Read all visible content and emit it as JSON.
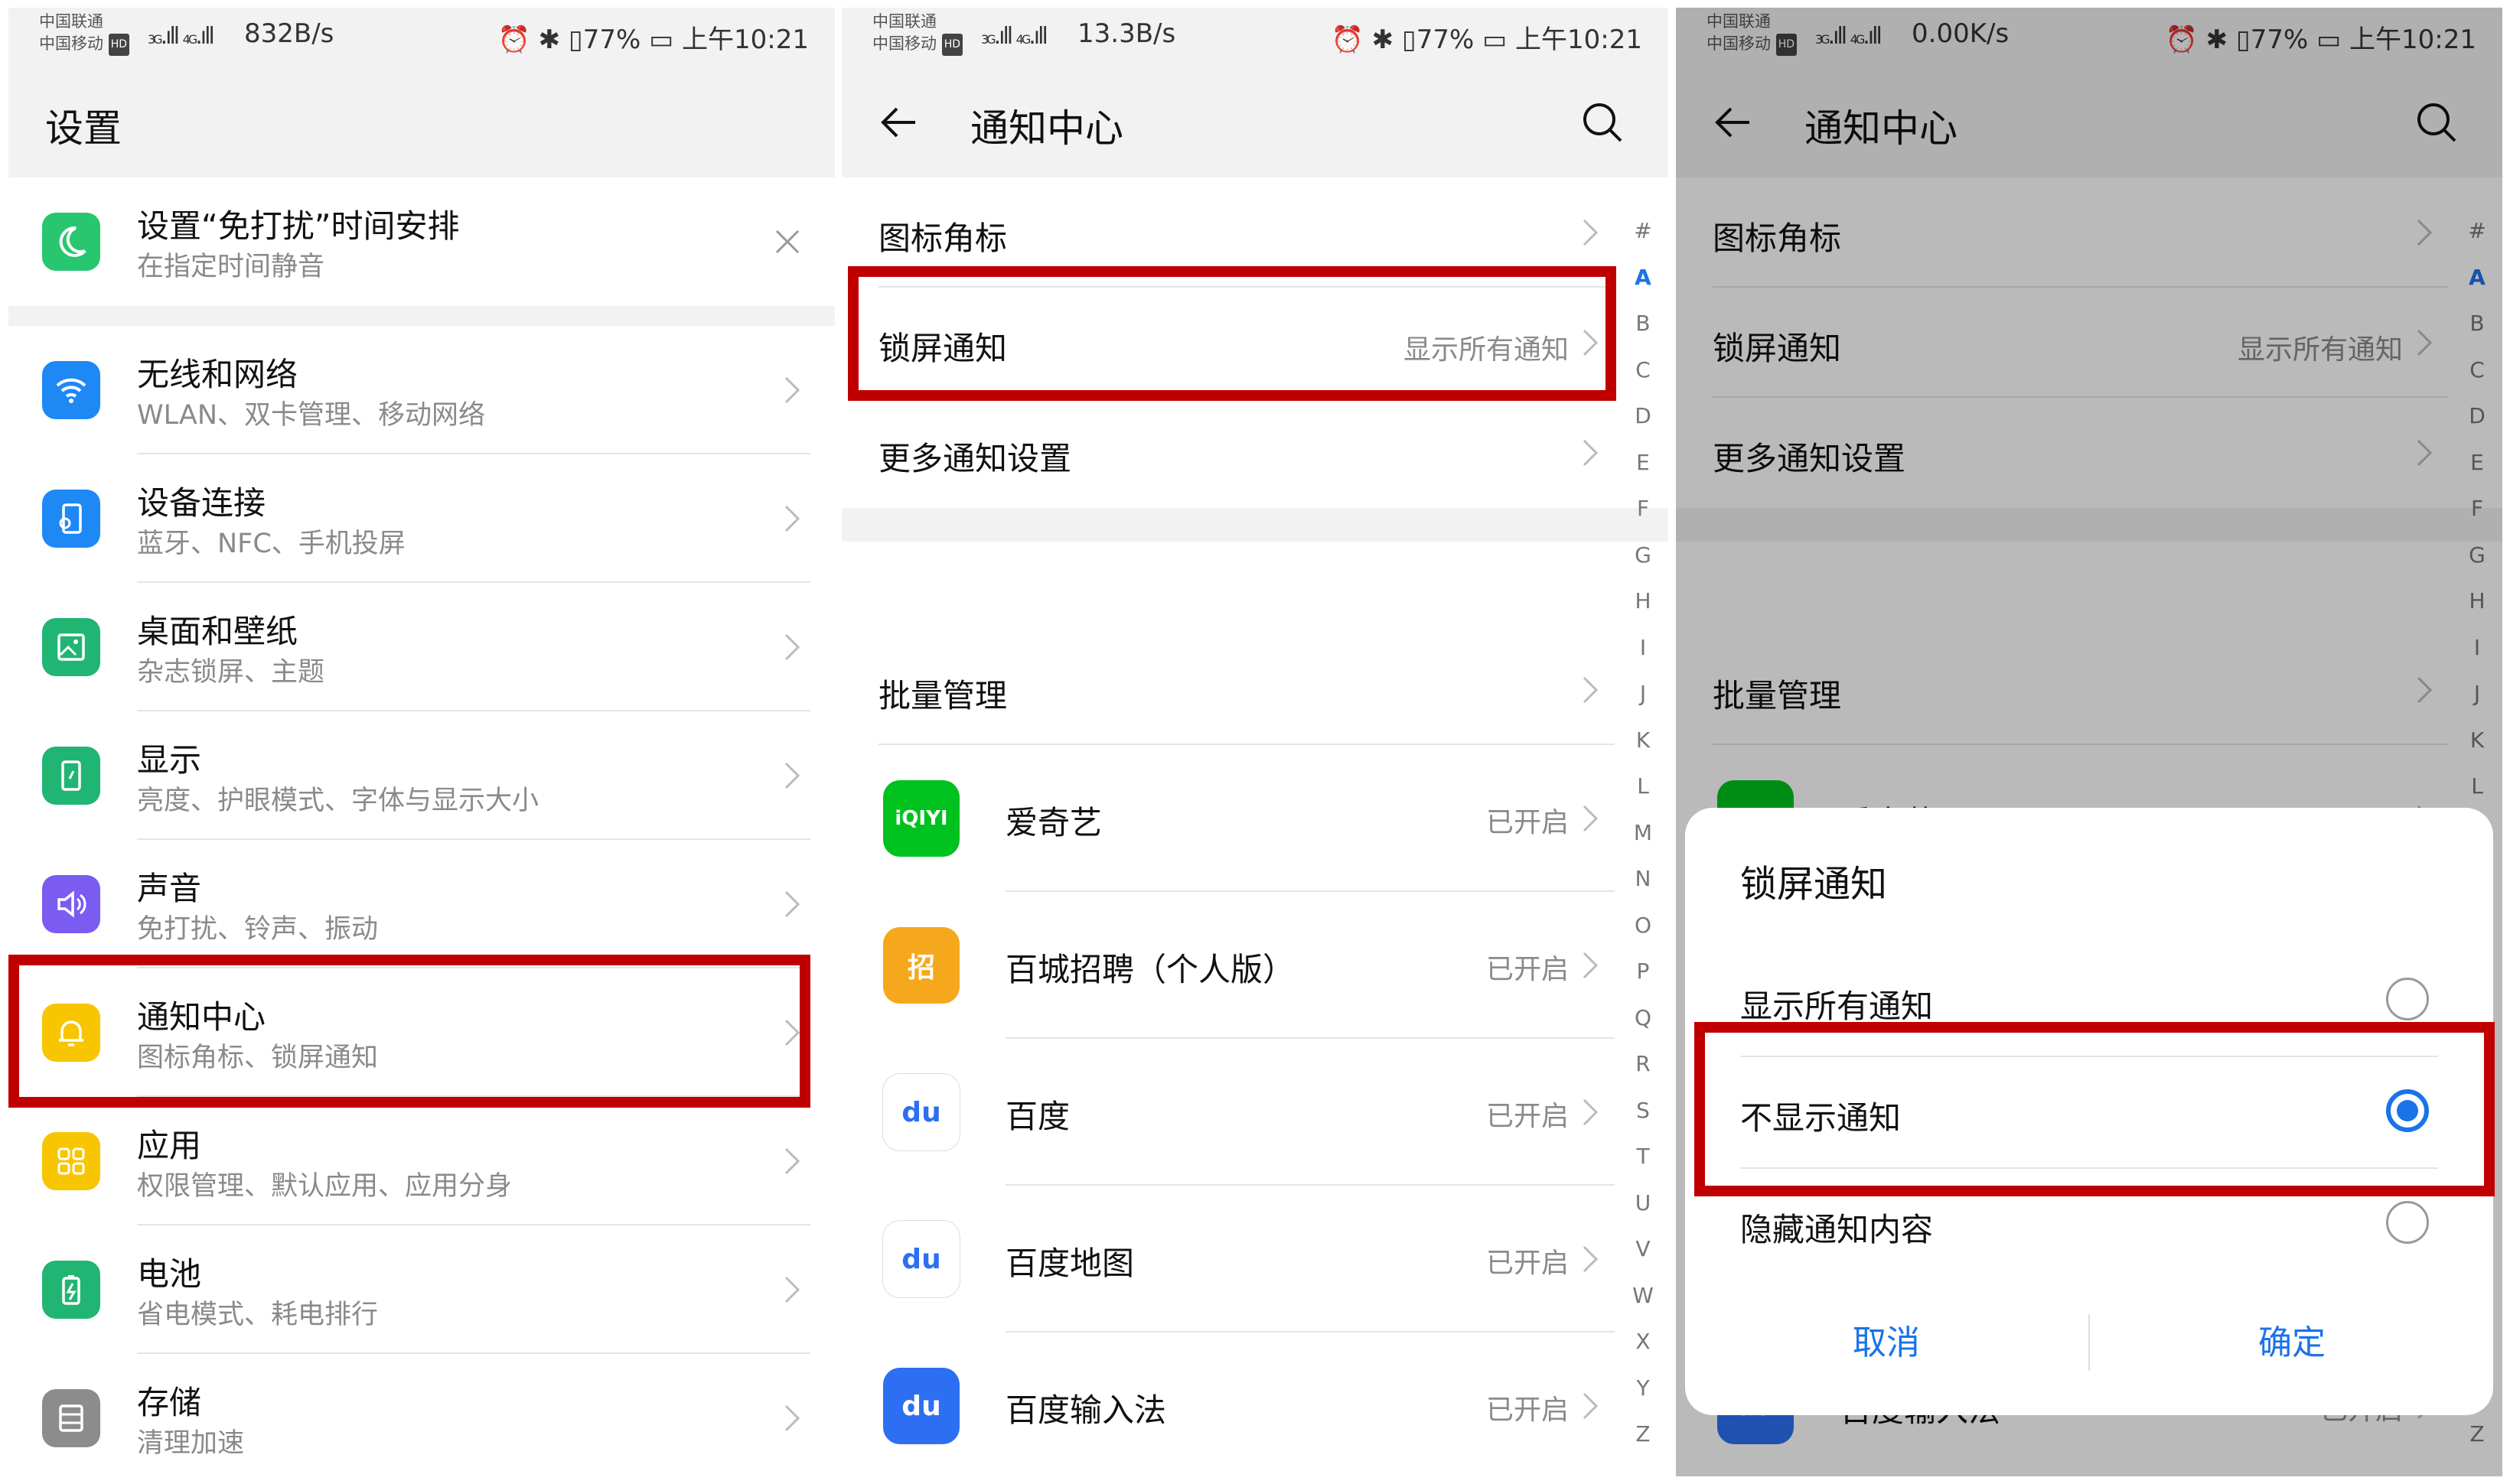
{
  "status_bars": [
    {
      "carrier1": "中国联通",
      "carrier2": "中国移动",
      "hd": "HD",
      "signal1": "3G",
      "signal2": "4G",
      "speed": "832B/s",
      "icons": "⏰ ✱ ▯",
      "battery": "77%",
      "time": "上午10:21"
    },
    {
      "carrier1": "中国联通",
      "carrier2": "中国移动",
      "hd": "HD",
      "signal1": "3G",
      "signal2": "4G",
      "speed": "13.3B/s",
      "icons": "⏰ ✱ ▯",
      "battery": "77%",
      "time": "上午10:21"
    },
    {
      "carrier1": "中国联通",
      "carrier2": "中国移动",
      "hd": "HD",
      "signal1": "3G",
      "signal2": "4G",
      "speed": "0.00K/s",
      "icons": "⏰ ✱ ▯",
      "battery": "77%",
      "time": "上午10:21"
    }
  ],
  "settings": {
    "title": "设置",
    "dnd": {
      "main": "设置“免打扰”时间安排",
      "sub": "在指定时间静音",
      "icon": "moon-icon",
      "color": "#28c76f"
    },
    "items": [
      {
        "main": "无线和网络",
        "sub": "WLAN、双卡管理、移动网络",
        "icon": "wifi-icon",
        "color": "#1e88f5"
      },
      {
        "main": "设备连接",
        "sub": "蓝牙、NFC、手机投屏",
        "icon": "device-connection-icon",
        "color": "#1e88f5"
      },
      {
        "main": "桌面和壁纸",
        "sub": "杂志锁屏、主题",
        "icon": "wallpaper-icon",
        "color": "#21b573"
      },
      {
        "main": "显示",
        "sub": "亮度、护眼模式、字体与显示大小",
        "icon": "display-icon",
        "color": "#21b573"
      },
      {
        "main": "声音",
        "sub": "免打扰、铃声、振动",
        "icon": "sound-icon",
        "color": "#7a5cf0"
      },
      {
        "main": "通知中心",
        "sub": "图标角标、锁屏通知",
        "icon": "bell-icon",
        "color": "#f7c600"
      },
      {
        "main": "应用",
        "sub": "权限管理、默认应用、应用分身",
        "icon": "apps-icon",
        "color": "#f7c600"
      },
      {
        "main": "电池",
        "sub": "省电模式、耗电排行",
        "icon": "battery-icon",
        "color": "#21b573"
      },
      {
        "main": "存储",
        "sub": "清理加速",
        "icon": "storage-icon",
        "color": "#8c8c8c"
      }
    ]
  },
  "notification_center": {
    "title": "通知中心",
    "badge_label": "图标角标",
    "lock_label": "锁屏通知",
    "lock_value": "显示所有通知",
    "more_label": "更多通知设置",
    "batch_label": "批量管理",
    "apps": [
      {
        "name": "爱奇艺",
        "status": "已开启",
        "icon": "iqiyi-icon",
        "color": "#00c21f",
        "glyph": "iQIYI"
      },
      {
        "name": "百城招聘（个人版）",
        "status": "已开启",
        "icon": "baicheng-icon",
        "color": "#f5a81c",
        "glyph": "招"
      },
      {
        "name": "百度",
        "status": "已开启",
        "icon": "baidu-icon",
        "color": "#ffffff",
        "glyph": "du"
      },
      {
        "name": "百度地图",
        "status": "已开启",
        "icon": "baidu-map-icon",
        "color": "#ffffff",
        "glyph": "du"
      },
      {
        "name": "百度输入法",
        "status": "已开启",
        "icon": "baidu-input-icon",
        "color": "#2d6ff2",
        "glyph": "du"
      }
    ],
    "index": [
      "#",
      "A",
      "B",
      "C",
      "D",
      "E",
      "F",
      "G",
      "H",
      "I",
      "J",
      "K",
      "L",
      "M",
      "N",
      "O",
      "P",
      "Q",
      "R",
      "S",
      "T",
      "U",
      "V",
      "W",
      "X",
      "Y",
      "Z"
    ],
    "index_active": "A"
  },
  "dialog": {
    "title": "锁屏通知",
    "options": [
      {
        "label": "显示所有通知",
        "selected": false
      },
      {
        "label": "不显示通知",
        "selected": true
      },
      {
        "label": "隐藏通知内容",
        "selected": false
      }
    ],
    "cancel": "取消",
    "confirm": "确定"
  },
  "colors": {
    "accent": "#1a73e8",
    "highlight": "#c00000"
  }
}
